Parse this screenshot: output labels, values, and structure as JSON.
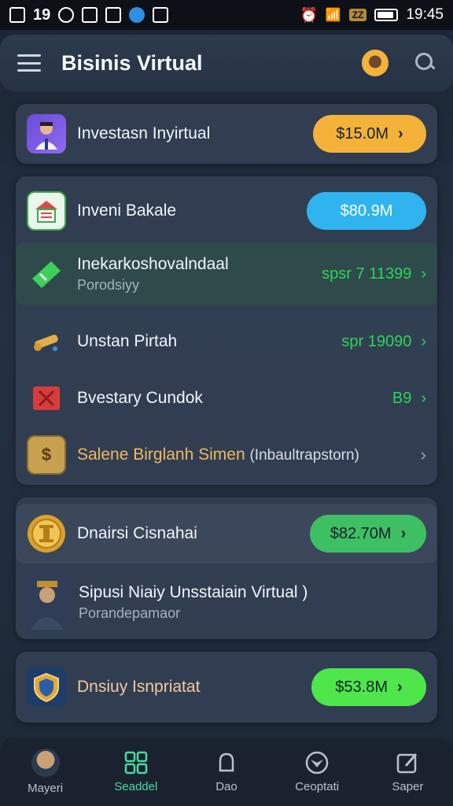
{
  "status_bar": {
    "time": "19:45",
    "left_text": "19",
    "badge": "ZZ"
  },
  "header": {
    "title": "Bisinis Virtual"
  },
  "rows": [
    {
      "label": "Investasn Inyirtual",
      "value": "$15.0M"
    },
    {
      "label": "Inveni Bakale",
      "value": "$80.9M"
    },
    {
      "label": "Inekarkoshovalndaal",
      "sub": "Porodsiyy",
      "value": "spsr 7 11399"
    },
    {
      "label": "Unstan Pirtah",
      "value": "spr 19090"
    },
    {
      "label": "Bvestary Cundok",
      "value": "B9"
    },
    {
      "label": "Salene Birglanh Simen",
      "sub_inline": "(Inbaultrapstorn)"
    },
    {
      "label": "Dnairsi Cisnahai",
      "value": "$82.70M"
    },
    {
      "label": "Sipusi Niaiy Unsstaiain Virtual )",
      "sub": "Porandepamaor"
    },
    {
      "label": "Dnsiuy Isnpriatat",
      "value": "$53.8M"
    }
  ],
  "nav": [
    {
      "label": "Mayeri"
    },
    {
      "label": "Seaddel"
    },
    {
      "label": "Dao"
    },
    {
      "label": "Ceoptati"
    },
    {
      "label": "Saper"
    }
  ],
  "colors": {
    "orange": "#f4b23a",
    "blue": "#2fb4f0",
    "green": "#3fbf63",
    "lime": "#4ee64a",
    "accent_green": "#2fd35b"
  },
  "icons": [
    "menu-icon",
    "avatar",
    "search-icon",
    "person-icon",
    "house-icon",
    "ticket-icon",
    "key-icon",
    "x-box-icon",
    "shield-s-icon",
    "gold-coin-icon",
    "shield-icon",
    "grid-icon",
    "bell-icon",
    "compass-icon",
    "edit-icon"
  ]
}
